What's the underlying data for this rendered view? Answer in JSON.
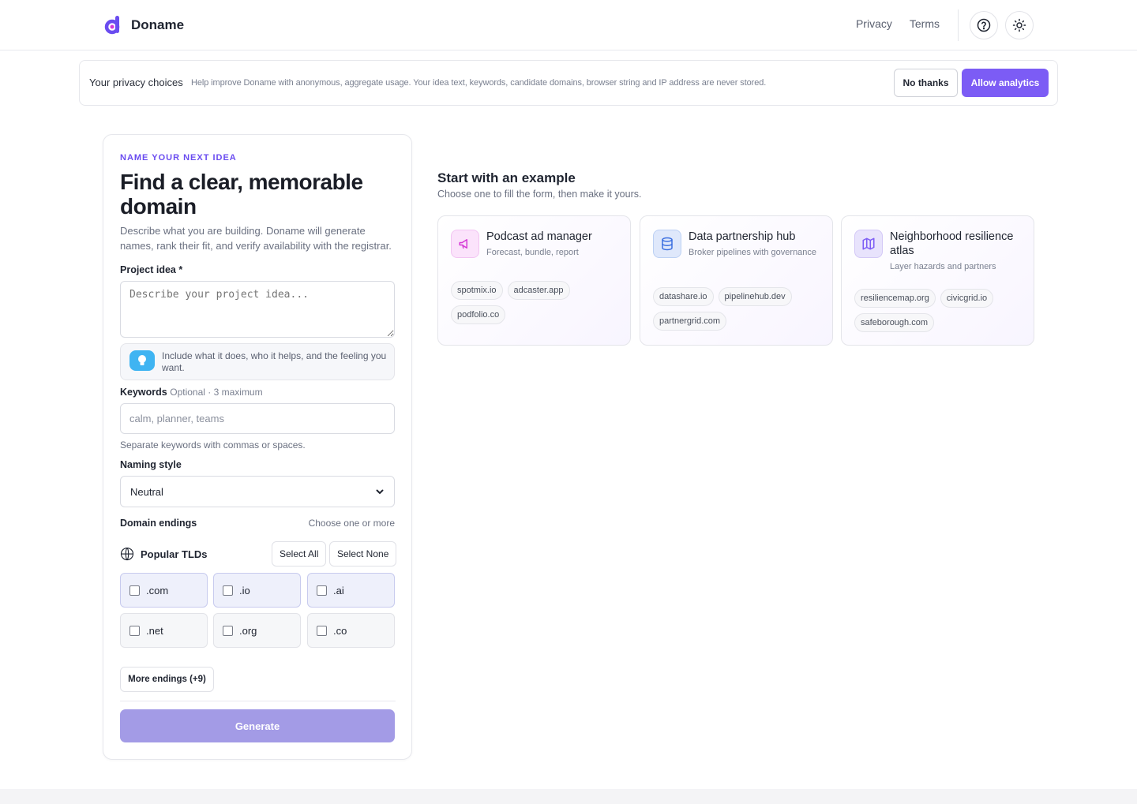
{
  "header": {
    "brand": "Doname",
    "nav": [
      "Privacy",
      "Terms"
    ],
    "icons": [
      "help-circle-icon",
      "sun-icon"
    ]
  },
  "privacy": {
    "title": "Your privacy choices",
    "text": "Help improve Doname with anonymous, aggregate usage. Your idea text, keywords, candidate domains, browser string and IP address are never stored.",
    "decline": "No thanks",
    "accept": "Allow analytics"
  },
  "form": {
    "eyebrow": "NAME YOUR NEXT IDEA",
    "headline": "Find a clear, memorable domain",
    "subtext": "Describe what you are building. Doname will generate names, rank their fit, and verify availability with the registrar.",
    "idea_label": "Project idea *",
    "idea_placeholder": "Describe your project idea...",
    "tip": "Include what it does, who it helps, and the feeling you want.",
    "keywords_label": "Keywords",
    "keywords_optional": "Optional · 3 maximum",
    "keywords_placeholder": "calm, planner, teams",
    "keywords_help": "Separate keywords with commas or spaces.",
    "style_label": "Naming style",
    "style_value": "Neutral",
    "endings_label": "Domain endings",
    "endings_hint": "Choose one or more",
    "popular_label": "Popular TLDs",
    "select_all": "Select All",
    "select_none": "Select None",
    "tlds": [
      ".com",
      ".io",
      ".ai",
      ".net",
      ".org",
      ".co"
    ],
    "more_endings": "More endings (+9)",
    "generate": "Generate"
  },
  "examples": {
    "title": "Start with an example",
    "subtitle": "Choose one to fill the form, then make it yours.",
    "cards": [
      {
        "title": "Podcast ad manager",
        "desc": "Forecast, bundle, report",
        "chips": [
          "spotmix.io",
          "adcaster.app",
          "podfolio.co"
        ],
        "icon": "megaphone-icon",
        "accent": "#d63ad6"
      },
      {
        "title": "Data partnership hub",
        "desc": "Broker pipelines with governance",
        "chips": [
          "datashare.io",
          "pipelinehub.dev",
          "partnergrid.com"
        ],
        "icon": "database-icon",
        "accent": "#3b6fe0"
      },
      {
        "title": "Neighborhood resilience atlas",
        "desc": "Layer hazards and partners",
        "chips": [
          "resiliencemap.org",
          "civicgrid.io",
          "safeborough.com"
        ],
        "icon": "map-icon",
        "accent": "#7c5cf5"
      }
    ]
  },
  "colors": {
    "accent": "#7c5cf5",
    "generate_disabled": "#a39be6",
    "tip_icon": "#3fb4f2"
  }
}
